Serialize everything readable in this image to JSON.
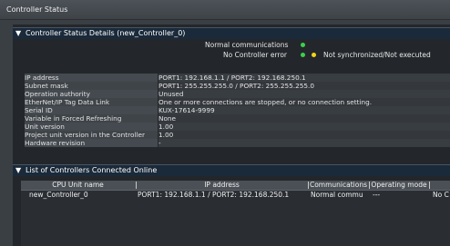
{
  "window": {
    "title": "Controller Status"
  },
  "status_section": {
    "title": "Controller Status Details (new_Controller_0)",
    "line1": "Normal communications",
    "line2": "No Controller error",
    "line2_note": "Not synchronized/Not executed",
    "colors": {
      "ok": "#3cd04a",
      "warn": "#f2d21b"
    }
  },
  "details": [
    {
      "key": "IP address",
      "value": "PORT1: 192.168.1.1 / PORT2: 192.168.250.1"
    },
    {
      "key": "Subnet mask",
      "value": "PORT1: 255.255.255.0 / PORT2: 255.255.255.0"
    },
    {
      "key": "Operation authority",
      "value": "Unused"
    },
    {
      "key": "EtherNet/IP Tag Data Link",
      "value": "One or more connections are stopped, or no connection setting."
    },
    {
      "key": "Serial ID",
      "value": "KUX-17614-9999"
    },
    {
      "key": "Variable in Forced Refreshing",
      "value": "None"
    },
    {
      "key": "Unit version",
      "value": "1.00"
    },
    {
      "key": "Project unit version in the Controller",
      "value": "1.00"
    },
    {
      "key": "Hardware revision",
      "value": "-"
    }
  ],
  "list_section": {
    "title": "List of Controllers Connected Online",
    "columns": [
      "CPU Unit name",
      "IP address",
      "Communications",
      "Operating mode"
    ],
    "rows": [
      {
        "cpu": "new_Controller_0",
        "ip": "PORT1: 192.168.1.1 / PORT2: 192.168.250.1",
        "comm": "Normal commu",
        "mode": "---",
        "extra": "No C"
      }
    ]
  }
}
